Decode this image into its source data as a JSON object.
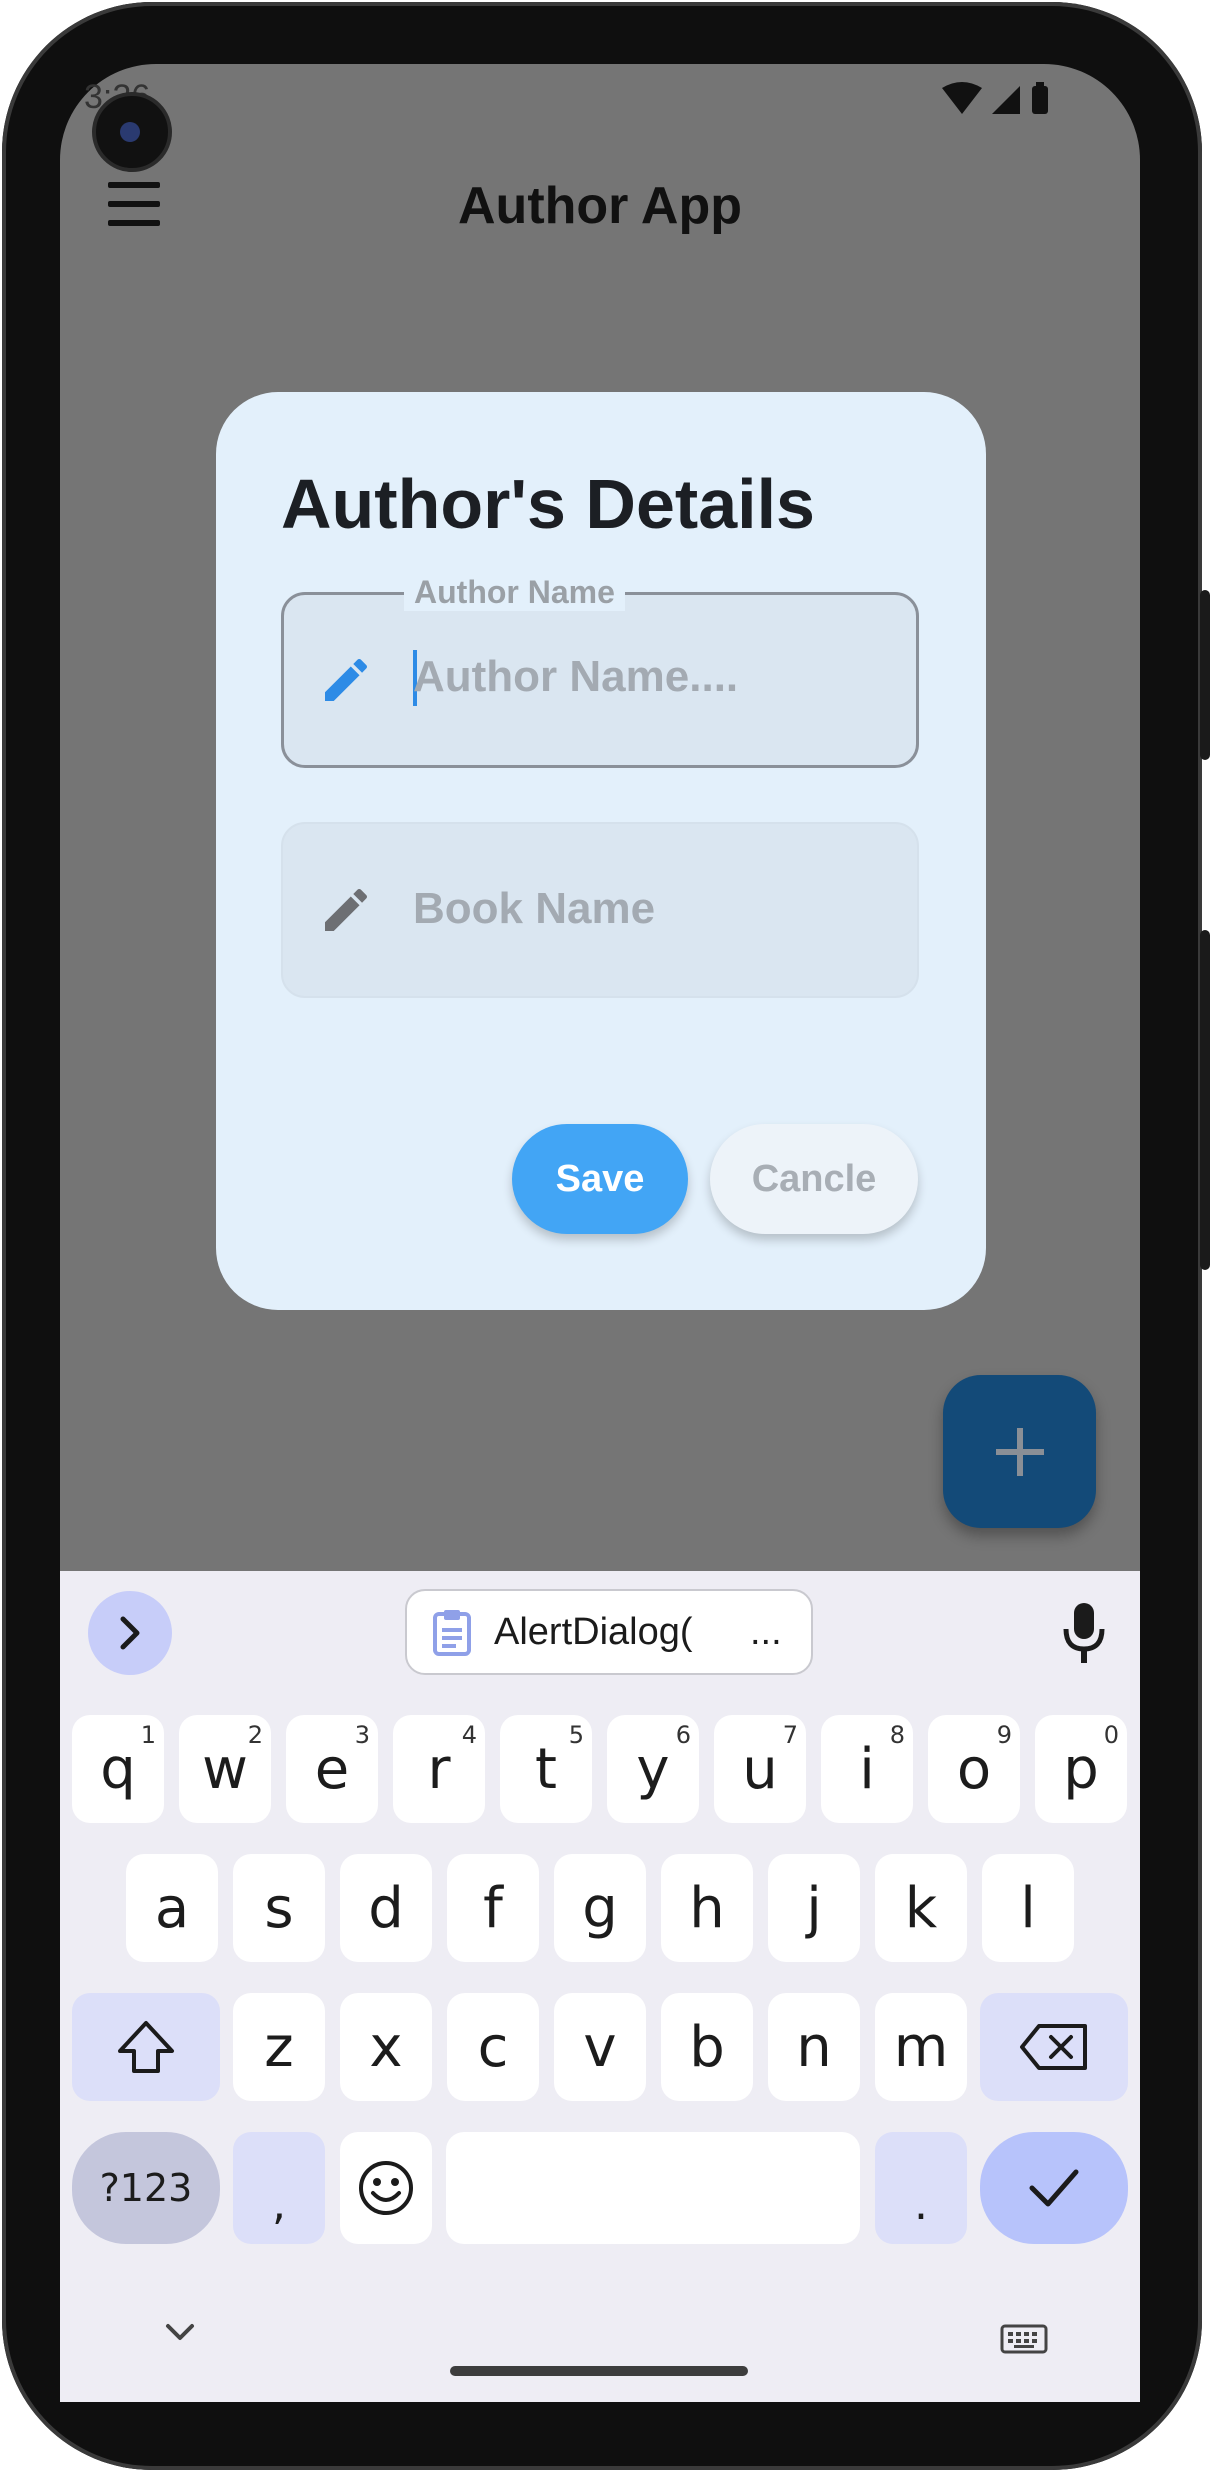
{
  "status_bar": {
    "time": "3:26"
  },
  "app_bar": {
    "title": "Author App"
  },
  "dialog": {
    "title": "Author's Details",
    "author_field": {
      "label": "Author Name",
      "placeholder": "Author Name...."
    },
    "book_field": {
      "placeholder": "Book Name"
    },
    "save_label": "Save",
    "cancel_label": "Cancle"
  },
  "keyboard": {
    "clipboard_suggestion": "AlertDialog(",
    "clipboard_more": "...",
    "row1": [
      {
        "key": "q",
        "hint": "1"
      },
      {
        "key": "w",
        "hint": "2"
      },
      {
        "key": "e",
        "hint": "3"
      },
      {
        "key": "r",
        "hint": "4"
      },
      {
        "key": "t",
        "hint": "5"
      },
      {
        "key": "y",
        "hint": "6"
      },
      {
        "key": "u",
        "hint": "7"
      },
      {
        "key": "i",
        "hint": "8"
      },
      {
        "key": "o",
        "hint": "9"
      },
      {
        "key": "p",
        "hint": "0"
      }
    ],
    "row2": [
      "a",
      "s",
      "d",
      "f",
      "g",
      "h",
      "j",
      "k",
      "l"
    ],
    "row3": [
      "z",
      "x",
      "c",
      "v",
      "b",
      "n",
      "m"
    ],
    "symbols_label": "?123",
    "comma_label": ",",
    "period_label": "."
  },
  "colors": {
    "accent": "#42a5f5",
    "fab": "#134a78",
    "dialog_bg": "#e3f0fb",
    "scrim": "#757575",
    "pencil_active": "#2d8be6",
    "pencil_inactive": "#6d6f73"
  },
  "icons": [
    "menu-icon",
    "pencil-icon",
    "add-icon",
    "chevron-right-icon",
    "clipboard-icon",
    "mic-icon",
    "shift-icon",
    "backspace-icon",
    "emoji-icon",
    "check-icon",
    "chevron-down-icon",
    "keyboard-icon"
  ]
}
